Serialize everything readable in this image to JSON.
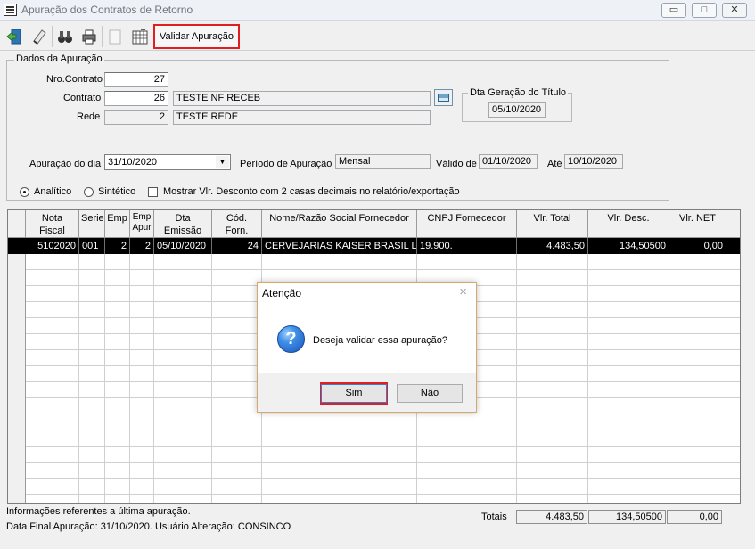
{
  "window": {
    "title": "Apuração dos Contratos de Retorno",
    "minimize": "▭",
    "restore": "□",
    "close": "✕"
  },
  "toolbar": {
    "validate_label": "Validar Apuração",
    "icons": [
      "exit-icon",
      "eraser-icon",
      "binoculars-icon",
      "printer-icon",
      "document-icon",
      "calendar-grid-icon"
    ]
  },
  "dados": {
    "group_title": "Dados da Apuração",
    "nro_contrato_label": "Nro.Contrato",
    "nro_contrato_value": "27",
    "contrato_label": "Contrato",
    "contrato_value": "26",
    "contrato_name": "TESTE NF RECEB",
    "rede_label": "Rede",
    "rede_value": "2",
    "rede_name": "TESTE REDE",
    "dta_geracao_title": "Dta Geração do Título",
    "dta_geracao_value": "05/10/2020",
    "apuracao_dia_label": "Apuração do dia",
    "apuracao_dia_value": "31/10/2020",
    "periodo_label": "Período de Apuração",
    "periodo_value": "Mensal",
    "valido_de_label": "Válido de",
    "valido_de_value": "01/10/2020",
    "ate_label": "Até",
    "ate_value": "10/10/2020"
  },
  "options": {
    "analitico": "Analítico",
    "sintetico": "Sintético",
    "mostrar_desconto": "Mostrar Vlr. Desconto com 2 casas decimais no relatório/exportação"
  },
  "grid": {
    "headers": [
      "Nota Fiscal",
      "Serie",
      "Emp",
      "Emp Apur",
      "Dta Emissão",
      "Cód. Forn.",
      "Nome/Razão Social Fornecedor",
      "CNPJ Fornecedor",
      "Vlr. Total",
      "Vlr. Desc.",
      "Vlr. NET"
    ],
    "rows": [
      [
        "5102020",
        "001",
        "2",
        "2",
        "05/10/2020",
        "24",
        "CERVEJARIAS KAISER BRASIL LT",
        "19.900.",
        "4.483,50",
        "134,50500",
        "0,00"
      ]
    ]
  },
  "footer": {
    "info_line1": "Informações referentes a última apuração.",
    "info_line2": "Data Final Apuração: 31/10/2020. Usuário Alteração: CONSINCO",
    "totais_label": "Totais",
    "total_vlr": "4.483,50",
    "total_desc": "134,50500",
    "total_net": "0,00"
  },
  "dialog": {
    "title": "Atenção",
    "close": "×",
    "icon": "question-icon",
    "message": "Deseja validar essa apuração?",
    "yes": "Sim",
    "no": "Não"
  },
  "colors": {
    "highlight_border": "#e02020",
    "selected_row": "#000000",
    "dialog_border": "#d7a86c"
  }
}
